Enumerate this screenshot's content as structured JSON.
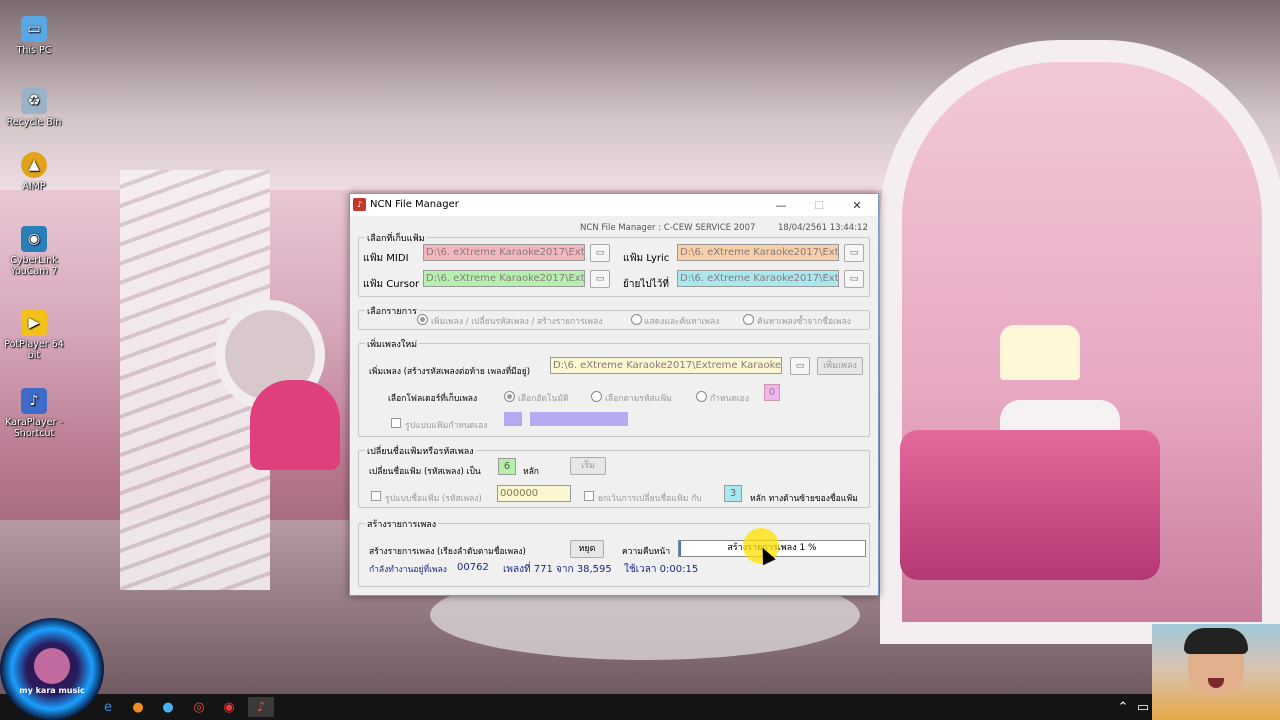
{
  "desktop": {
    "icons": [
      {
        "label": "This PC",
        "color": "#5aa7e6",
        "glyph": "monitor-icon"
      },
      {
        "label": "Recycle Bin",
        "color": "#9bb3c8",
        "glyph": "recycle-bin-icon"
      },
      {
        "label": "AIMP",
        "color": "#e2a21b",
        "glyph": "aimp-icon"
      },
      {
        "label": "CyberLink YouCam 7",
        "color": "#2b7fb8",
        "glyph": "youcam-icon"
      },
      {
        "label": "PotPlayer 64 bit",
        "color": "#f2c21a",
        "glyph": "potplayer-icon"
      },
      {
        "label": "KaraPlayer - Shortcut",
        "color": "#3e6bc7",
        "glyph": "karaplayer-icon"
      }
    ]
  },
  "badge": {
    "text": "my kara music"
  },
  "window": {
    "title": "NCN File Manager",
    "header_left": "NCN File Manager : C-CEW SERVICE 2007",
    "header_right": "18/04/2561 13:44:12",
    "folders": {
      "group_title": "เลือกที่เก็บแฟ้ม",
      "midi_label": "แฟ้ม MIDI",
      "midi_value": "D:\\6. eXtreme Karaoke2017\\Ext",
      "cursor_label": "แฟ้ม Cursor",
      "cursor_value": "D:\\6. eXtreme Karaoke2017\\Ext",
      "lyric_label": "แฟ้ม Lyric",
      "lyric_value": "D:\\6. eXtreme Karaoke2017\\Ext",
      "move_label": "ย้ายไปไว้ที่",
      "move_value": "D:\\6. eXtreme Karaoke2017\\Ext",
      "midi_color": "#f3b8be",
      "lyric_color": "#f7cfa8",
      "cursor_color": "#b6f0b0",
      "move_color": "#a9e8ef"
    },
    "options": {
      "group_title": "เลือกรายการ",
      "opt1": "เพิ่มเพลง / เปลี่ยนรหัสเพลง / สร้างรายการเพลง",
      "opt2": "แสดงและค้นหาเพลง",
      "opt3": "ค้นหาเพลงซ้ำจากชื่อเพลง"
    },
    "add_song": {
      "group_title": "เพิ่มเพลงใหม่",
      "add_label": "เพิ่มเพลง (สร้างรหัสเพลงต่อท้าย เพลงที่มีอยู่)",
      "add_value": "D:\\6. eXtreme Karaoke2017\\Extreme Karaoke",
      "add_button": "เพิ่มเพลง",
      "folder_select_label": "เลือกโฟลเดอร์ที่เก็บเพลง",
      "auto_label": "เลือกอัตโนมัติ",
      "by_code_label": "เลือกตามรหัสแฟ้ม",
      "manual_label": "กำหนดเอง",
      "manual_value": "0",
      "custom_format_label": "รูปแบบแฟ้มกำหนดเอง"
    },
    "rename": {
      "group_title": "เปลี่ยนชื่อแฟ้มหรือรหัสเพลง",
      "rename_label": "เปลี่ยนชื่อแฟ้ม (รหัสเพลง) เป็น",
      "digits_value": "6",
      "digits_unit": "หลัก",
      "start_button": "เริ่ม",
      "format_label": "รูปแบบชื่อแฟ้ม (รหัสเพลง)",
      "format_value": "000000",
      "except_label": "ยกเว้นการเปลี่ยนชื่อแฟ้ม กับ",
      "except_value": "3",
      "except_suffix": "หลัก ทางด้านซ้ายของชื่อแฟ้ม"
    },
    "list": {
      "group_title": "สร้างรายการเพลง",
      "create_label": "สร้างรายการเพลง (เรียงลำดับตามชื่อเพลง)",
      "stop_button": "หยุด",
      "progress_label": "ความคืบหน้า",
      "progress_text": "สร้างรายการเพลง 1 %",
      "progress_percent": 1,
      "working_label": "กำลังทำงานอยู่ที่เพลง",
      "working_value": "00762",
      "song_status": "เพลงที่ 771 จาก 38,595",
      "time_status": "ใช้เวลา 0:00:15"
    }
  }
}
